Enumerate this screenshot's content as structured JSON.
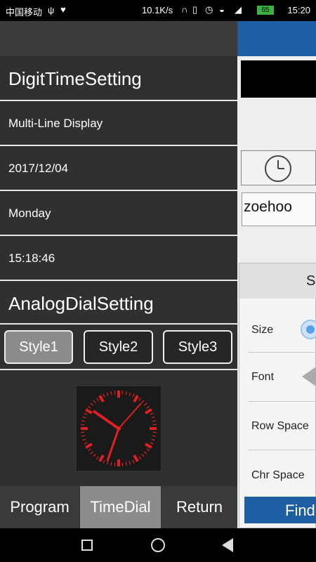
{
  "status_bar": {
    "carrier": "中国移动",
    "net_speed": "10.1K/s",
    "battery": "65",
    "time": "15:20"
  },
  "drawer": {
    "digit_header": "DigitTimeSetting",
    "multi_line": "Multi-Line Display",
    "date": "2017/12/04",
    "weekday": "Monday",
    "time": "15:18:46",
    "analog_header": "AnalogDialSetting",
    "styles": [
      "Style1",
      "Style2",
      "Style3"
    ],
    "selected_style": "Style1"
  },
  "tabs": {
    "items": [
      "Program",
      "TimeDial",
      "Return"
    ],
    "active": "TimeDial"
  },
  "right_panel": {
    "input_value": "zoehoo",
    "settings_header": "S",
    "labels": [
      "Size",
      "Font",
      "Row Space",
      "Chr Space"
    ],
    "find_button": "Find"
  },
  "colors": {
    "accent_blue": "#1f5ea3",
    "dial_red": "#e02020",
    "active_tab": "#8c8c8c"
  }
}
